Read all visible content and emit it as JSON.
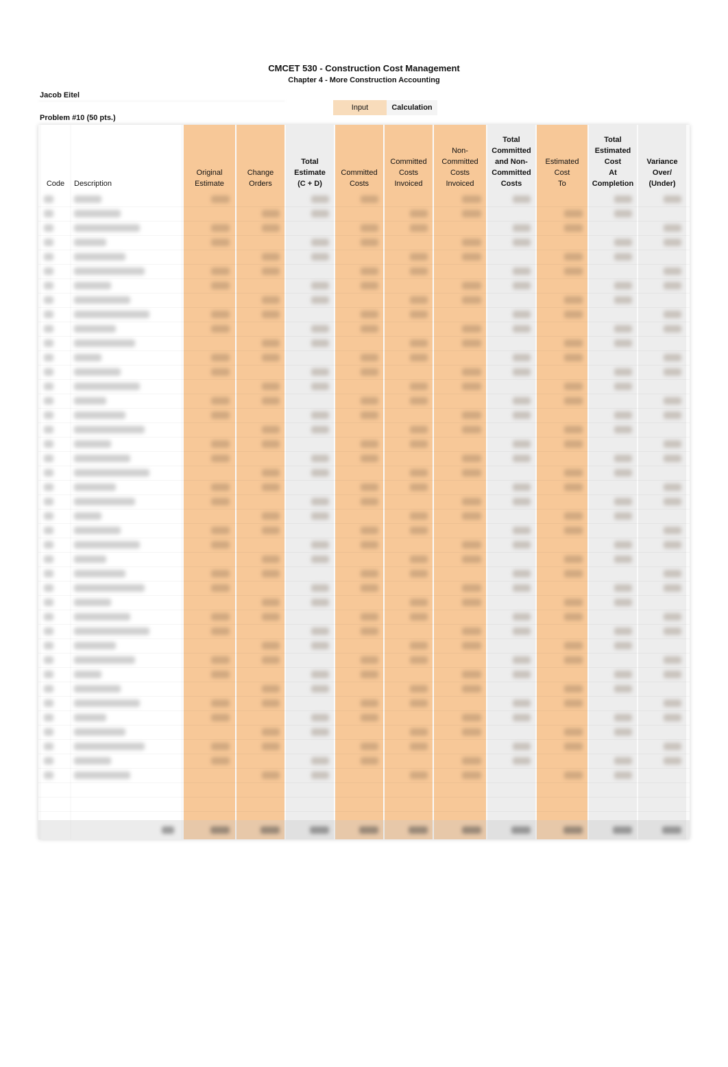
{
  "header": {
    "course_title": "CMCET 530 - Construction Cost Management",
    "chapter_title": "Chapter 4 - More Construction Accounting",
    "student_name": "Jacob Eitel",
    "problem_label": "Problem #10 (50 pts.)"
  },
  "legend": {
    "input_label": "Input",
    "calculation_label": "Calculation",
    "input_color": "#f7c898",
    "calculation_color": "#ededed"
  },
  "table": {
    "columns": [
      {
        "key": "code",
        "lines": [
          "Code"
        ],
        "type": "plain"
      },
      {
        "key": "description",
        "lines": [
          "Description"
        ],
        "type": "plain"
      },
      {
        "key": "original_estimate",
        "lines": [
          "Original",
          "Estimate"
        ],
        "type": "input"
      },
      {
        "key": "change_orders",
        "lines": [
          "Change",
          "Orders"
        ],
        "type": "input"
      },
      {
        "key": "total_estimate",
        "lines": [
          "Total",
          "Estimate",
          "(C + D)"
        ],
        "type": "calc"
      },
      {
        "key": "committed_costs",
        "lines": [
          "Committed",
          "Costs"
        ],
        "type": "input"
      },
      {
        "key": "committed_costs_invoiced",
        "lines": [
          "Committed",
          "Costs",
          "Invoiced"
        ],
        "type": "input"
      },
      {
        "key": "non_committed_costs_invoiced",
        "lines": [
          "Non-",
          "Committed",
          "Costs",
          "Invoiced"
        ],
        "type": "input"
      },
      {
        "key": "total_committed_and_non_committed",
        "lines": [
          "Total",
          "Committed",
          "and Non-",
          "Committed",
          "Costs"
        ],
        "type": "calc"
      },
      {
        "key": "estimated_cost_to",
        "lines": [
          "Estimated",
          "Cost",
          "To"
        ],
        "type": "input"
      },
      {
        "key": "total_estimated_cost_at_completion",
        "lines": [
          "Total",
          "Estimated",
          "Cost",
          "At",
          "Completion"
        ],
        "type": "calc"
      },
      {
        "key": "variance",
        "lines": [
          "Variance",
          "Over/",
          "(Under)"
        ],
        "type": "calc"
      }
    ],
    "rows_note": "Row contents are blurred/illegible in the screenshot",
    "row_count": 43
  }
}
